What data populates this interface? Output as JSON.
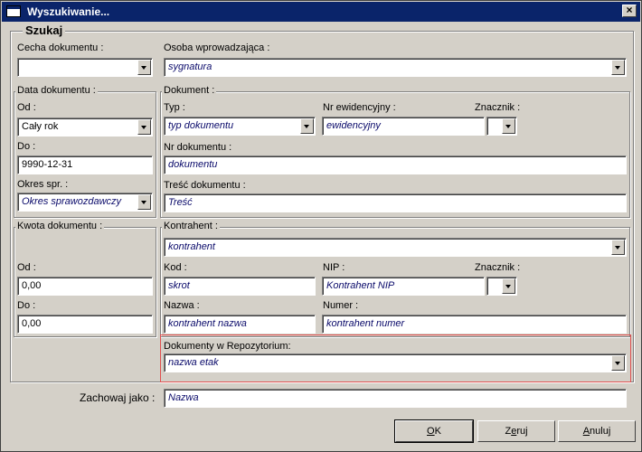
{
  "window": {
    "title": "Wyszukiwanie...",
    "close_label": "×"
  },
  "group": {
    "title": "Szukaj"
  },
  "cecha": {
    "label": "Cecha dokumentu :",
    "value": ""
  },
  "osoba": {
    "label": "Osoba wprowadzająca :",
    "value": "sygnatura"
  },
  "data_dok": {
    "title": "Data dokumentu :",
    "od_label": "Od :",
    "od_value": "Cały rok",
    "do_label": "Do :",
    "do_value": "9990-12-31",
    "okres_label": "Okres spr. :",
    "okres_value": "Okres sprawozdawczy"
  },
  "dokument": {
    "title": "Dokument :",
    "typ_label": "Typ :",
    "typ_value": "typ dokumentu",
    "nrew_label": "Nr ewidencyjny :",
    "nrew_value": "ewidencyjny",
    "znacznik_label": "Znacznik :",
    "nrdok_label": "Nr dokumentu :",
    "nrdok_value": "dokumentu",
    "tresc_label": "Treść dokumentu :",
    "tresc_value": "Treść"
  },
  "kwota": {
    "title": "Kwota dokumentu :",
    "od_label": "Od :",
    "od_value": "0,00",
    "do_label": "Do :",
    "do_value": "0,00"
  },
  "kontrahent": {
    "title": "Kontrahent :",
    "value": "kontrahent",
    "kod_label": "Kod :",
    "kod_value": "skrot",
    "nip_label": "NIP :",
    "nip_value": "Kontrahent NIP",
    "znacznik_label": "Znacznik :",
    "nazwa_label": "Nazwa :",
    "nazwa_value": "kontrahent nazwa",
    "numer_label": "Numer :",
    "numer_value": "kontrahent numer"
  },
  "repozytorium": {
    "label": "Dokumenty w Repozytorium:",
    "value": "nazwa etak"
  },
  "zachowaj": {
    "label": "Zachowaj jako :",
    "value": "Nazwa"
  },
  "buttons": {
    "ok_u": "O",
    "ok_rest": "K",
    "zeruj_pre": "Z",
    "zeruj_u": "e",
    "zeruj_rest": "ruj",
    "anuluj_u": "A",
    "anuluj_rest": "nuluj"
  },
  "colors": {
    "titlebar": "#0a246a",
    "face": "#d4d0c8",
    "highlight_box": "#e05050",
    "placeholder": "#0a0a6a"
  }
}
